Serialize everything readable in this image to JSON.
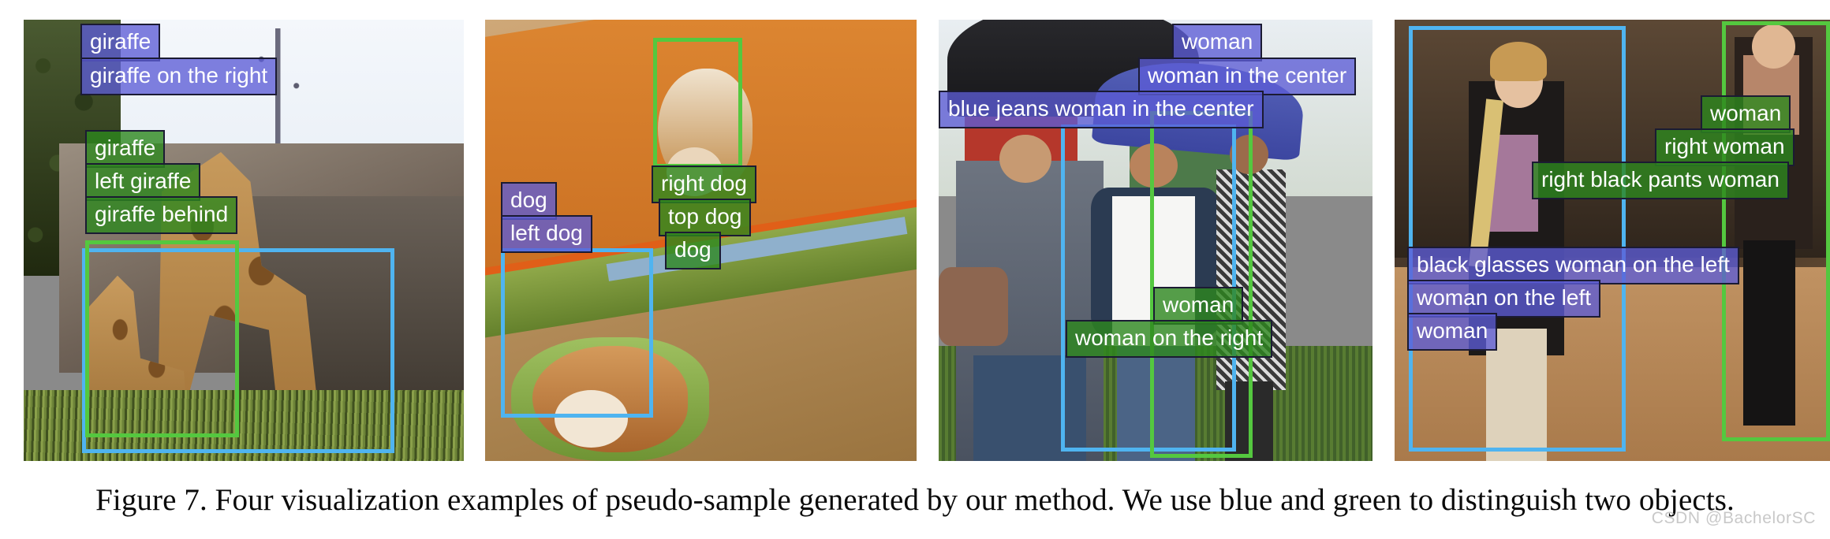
{
  "figure": {
    "caption": "Figure 7. Four visualization examples of pseudo-sample generated by our method. We use blue and green to distinguish two objects.",
    "watermark": "CSDN @BachelorSC",
    "colors": {
      "blue_box": "#4fb4f0",
      "green_box": "#54c83f",
      "blue_label_bg": "#5c5cd6",
      "green_label_bg": "#2d871e",
      "label_text": "#ffffff",
      "label_border": "#1b1b33",
      "page_background": "#ffffff",
      "caption_text": "#0a0a0a"
    }
  },
  "panels": [
    {
      "id": "panel-giraffes",
      "scene": "two giraffes in a zoo enclosure with trees and rock wall",
      "labels": [
        {
          "text": "giraffe",
          "color": "blue"
        },
        {
          "text": "giraffe on the right",
          "color": "blue"
        },
        {
          "text": "giraffe",
          "color": "green"
        },
        {
          "text": "left giraffe",
          "color": "green"
        },
        {
          "text": "giraffe behind",
          "color": "green"
        }
      ],
      "boxes": [
        {
          "color": "blue",
          "object": "giraffe on the right"
        },
        {
          "color": "green",
          "object": "left giraffe"
        }
      ]
    },
    {
      "id": "panel-dogs",
      "scene": "two shiba dogs on an orange and green blanket bed",
      "labels": [
        {
          "text": "dog",
          "color": "blue"
        },
        {
          "text": "left dog",
          "color": "blue"
        },
        {
          "text": "right dog",
          "color": "green"
        },
        {
          "text": "top dog",
          "color": "green"
        },
        {
          "text": "dog",
          "color": "green"
        }
      ],
      "boxes": [
        {
          "color": "blue",
          "object": "left dog"
        },
        {
          "color": "green",
          "object": "top dog"
        }
      ]
    },
    {
      "id": "panel-umbrella-women",
      "scene": "group of people outdoors under umbrellas",
      "labels": [
        {
          "text": "woman",
          "color": "blue"
        },
        {
          "text": "woman in the center",
          "color": "blue"
        },
        {
          "text": "blue jeans woman in the center",
          "color": "blue"
        },
        {
          "text": "woman",
          "color": "green"
        },
        {
          "text": "woman on the right",
          "color": "green"
        }
      ],
      "boxes": [
        {
          "color": "blue",
          "object": "blue jeans woman in the center"
        },
        {
          "color": "green",
          "object": "woman on the right"
        }
      ]
    },
    {
      "id": "panel-street-women",
      "scene": "woman with glasses talking on a phone walking on a street",
      "labels": [
        {
          "text": "woman",
          "color": "green"
        },
        {
          "text": "right woman",
          "color": "green"
        },
        {
          "text": "right black pants woman",
          "color": "green"
        },
        {
          "text": "black glasses woman on the left",
          "color": "blue"
        },
        {
          "text": "woman on the left",
          "color": "blue"
        },
        {
          "text": "woman",
          "color": "blue"
        }
      ],
      "boxes": [
        {
          "color": "blue",
          "object": "black glasses woman on the left"
        },
        {
          "color": "green",
          "object": "right black pants woman"
        }
      ]
    }
  ]
}
